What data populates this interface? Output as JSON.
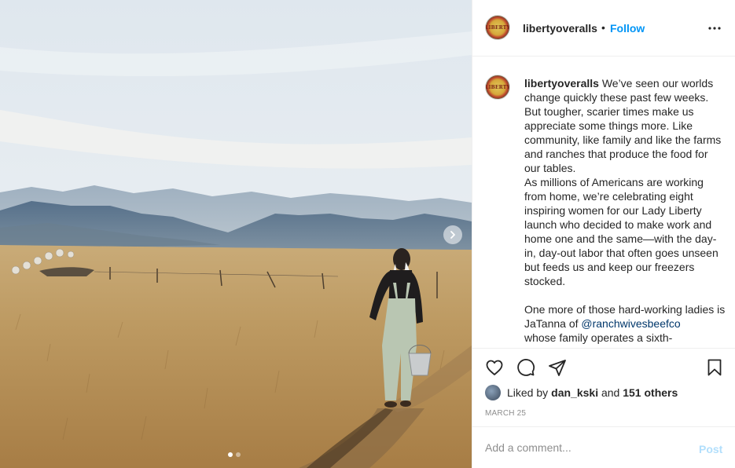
{
  "post": {
    "account": "libertyoveralls",
    "avatar_text": "LIBERTY",
    "separator": "•",
    "follow_label": "Follow",
    "caption": {
      "username": "libertyoveralls",
      "text_1": " We’ve seen our worlds change quickly these past few weeks. But tougher, scarier times make us appreciate some things more. Like community, like family and like the farms and ranches that produce the food for our tables.\nAs millions of Americans are working from home, we’re celebrating eight inspiring women for our Lady Liberty launch who decided to make work and home one and the same—with the day-in, day-out labor that often goes unseen but feeds us and keep our freezers stocked.\n\nOne more of those hard-working ladies is JaTanna of ",
      "mention": "@ranchwivesbeefco",
      "text_2": "\nwhose family operates a sixth-"
    },
    "likes": {
      "prefix": "Liked by ",
      "user": "dan_kski",
      "middle": " and ",
      "count": "151 others"
    },
    "date": "MARCH 25",
    "comment": {
      "placeholder": "Add a comment...",
      "post_label": "Post"
    },
    "carousel": {
      "total": 2,
      "active_index": 0
    }
  },
  "colors": {
    "accent": "#0095f6",
    "mention": "#00376b",
    "muted": "#8e8e8e",
    "post_disabled": "#b2dffc"
  },
  "icons": [
    "more-options-icon",
    "heart-icon",
    "comment-icon",
    "share-icon",
    "bookmark-icon",
    "chevron-right-icon"
  ]
}
